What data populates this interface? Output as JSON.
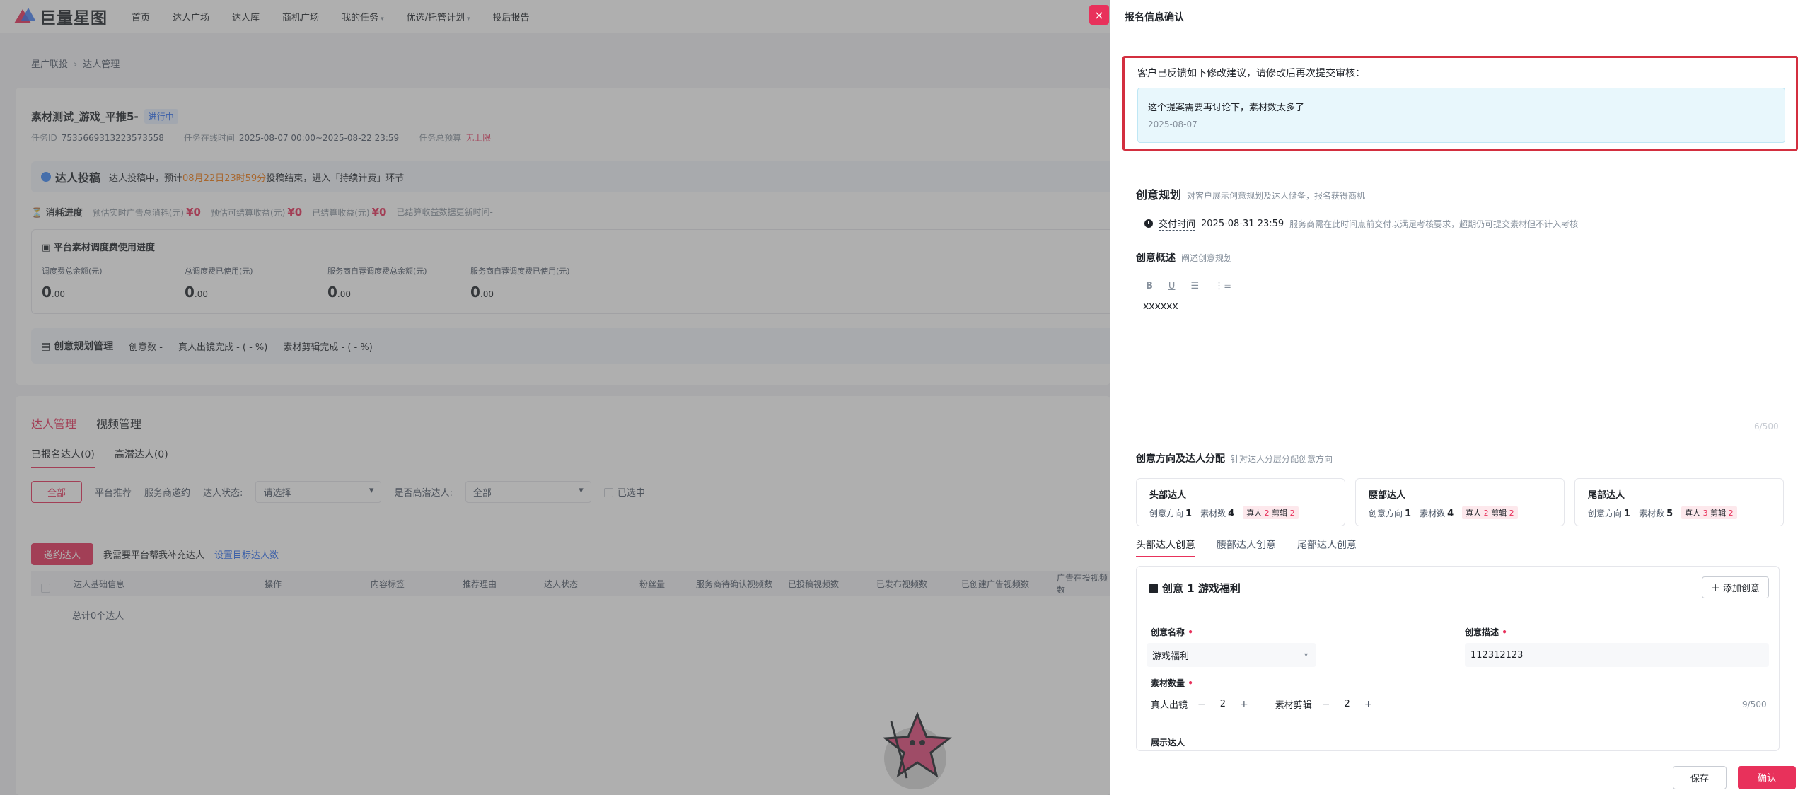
{
  "nav": {
    "logo_text": "巨量星图",
    "items": [
      "首页",
      "达人广场",
      "达人库",
      "商机广场",
      "我的任务",
      "优选/托管计划",
      "投后报告"
    ],
    "dropdown_caret": "▾"
  },
  "breadcrumb": {
    "parent": "星广联投",
    "sep": "›",
    "current": "达人管理"
  },
  "task": {
    "title": "素材测试_游戏_平推5-",
    "status": "进行中",
    "id_label": "任务ID",
    "id_value": "7535669313223573558",
    "online_label": "任务在线时间",
    "online_value": "2025-08-07 00:00~2025-08-22 23:59",
    "budget_label": "任务总预算",
    "budget_value": "无上限"
  },
  "banner": {
    "title": "达人投稿",
    "text_pre": "达人投稿中，预计",
    "highlight": "08月22日23时59分",
    "text_post": "投稿结束，进入「持续计费」环节"
  },
  "consume": {
    "label": "消耗进度",
    "items": [
      {
        "k": "预估实时广告总消耗(元)",
        "v": "¥0"
      },
      {
        "k": "预估可结算收益(元)",
        "v": "¥0"
      },
      {
        "k": "已结算收益(元)",
        "v": "¥0"
      }
    ],
    "note": "已结算收益数据更新时间-"
  },
  "usage": {
    "title": "平台素材调度费使用进度",
    "cols": [
      {
        "k": "调度费总余额(元)",
        "v": "0",
        "d": ".00"
      },
      {
        "k": "总调度费已使用(元)",
        "v": "0",
        "d": ".00"
      },
      {
        "k": "服务商自荐调度费总余额(元)",
        "v": "0",
        "d": ".00"
      },
      {
        "k": "服务商自荐调度费已使用(元)",
        "v": "0",
        "d": ".00"
      }
    ]
  },
  "plan_bar": {
    "title": "创意规划管理",
    "a": "创意数 -",
    "b": "真人出镜完成 - ( - %)",
    "c": "素材剪辑完成 - ( - %)"
  },
  "list": {
    "main_tabs": [
      "达人管理",
      "视频管理"
    ],
    "sub_tabs": [
      "已报名达人(0)",
      "高潜达人(0)"
    ],
    "filter_all": "全部",
    "filter_platform": "平台推荐",
    "filter_service": "服务商邀约",
    "status_label": "达人状态:",
    "status_placeholder": "请选择",
    "potential_label": "是否高潜达人:",
    "potential_value": "全部",
    "selected_label": "已选中",
    "invite_btn": "邀约达人",
    "invite_text": "我需要平台帮我补充达人",
    "invite_link": "设置目标达人数",
    "columns": [
      "达人基础信息",
      "操作",
      "内容标签",
      "推荐理由",
      "达人状态",
      "粉丝量",
      "服务商待确认视频数",
      "已投稿视频数",
      "已发布视频数",
      "已创建广告视频数",
      "广告在投视频数"
    ],
    "total": "总计0个达人"
  },
  "drawer": {
    "title": "报名信息确认",
    "close": "×",
    "feedback": {
      "head": "客户已反馈如下修改建议，请修改后再次提交审核：",
      "message": "这个提案需要再讨论下，素材数太多了",
      "date": "2025-08-07"
    },
    "plan": {
      "title": "创意规划",
      "sub": "对客户展示创意规划及达人储备，报名获得商机",
      "deliver_label": "交付时间",
      "deliver_value": "2025-08-31 23:59",
      "deliver_note": "服务商需在此时间点前交付以满足考核要求，超期仍可提交素材但不计入考核"
    },
    "overview": {
      "title": "创意概述",
      "sub": "阐述创意规划",
      "toolbar": [
        "B",
        "U",
        "☰",
        "⋮≡"
      ],
      "text": "xxxxxx",
      "counter": "6/500"
    },
    "direction": {
      "title": "创意方向及达人分配",
      "sub": "针对达人分层分配创意方向",
      "cards": [
        {
          "name": "头部达人",
          "dir_label": "创意方向",
          "dir": "1",
          "mat_label": "素材数",
          "mat": "4",
          "real": "2",
          "edit": "2"
        },
        {
          "name": "腰部达人",
          "dir_label": "创意方向",
          "dir": "1",
          "mat_label": "素材数",
          "mat": "4",
          "real": "2",
          "edit": "2"
        },
        {
          "name": "尾部达人",
          "dir_label": "创意方向",
          "dir": "1",
          "mat_label": "素材数",
          "mat": "5",
          "real": "3",
          "edit": "2"
        }
      ],
      "real_label": "真人",
      "edit_label": "剪辑"
    },
    "tabs": [
      "头部达人创意",
      "腰部达人创意",
      "尾部达人创意"
    ],
    "idea": {
      "title": "创意 1 游戏福利",
      "add_btn": "＋ 添加创意",
      "name_label": "创意名称",
      "name_value": "游戏福利",
      "desc_label": "创意描述",
      "desc_value": "112312123",
      "qty_label": "素材数量",
      "real_label": "真人出镜",
      "real_value": "2",
      "edit_label": "素材剪辑",
      "edit_value": "2",
      "counter": "9/500",
      "show_label": "展示达人"
    },
    "save": "保存",
    "confirm": "确认"
  }
}
